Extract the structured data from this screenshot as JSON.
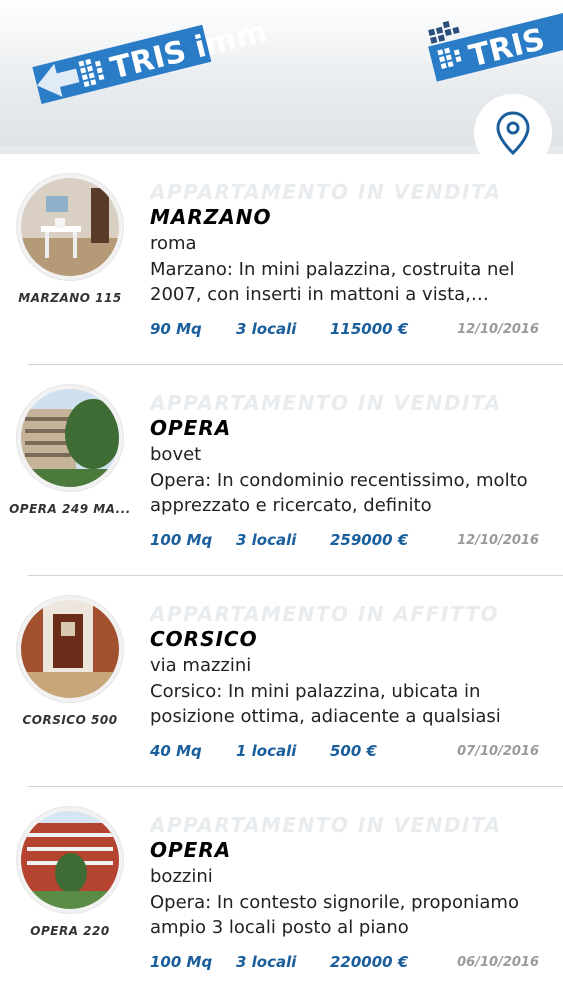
{
  "header": {
    "logo_left_text": "TRIS imm",
    "logo_right_text": "TRIS",
    "map_button_icon": "map-pin-icon"
  },
  "colors": {
    "brand_blue": "#1a5e9c",
    "logo_blue": "#2a7cc7",
    "date_gray": "#9a9a9a",
    "watermark_gray": "#e9ecef"
  },
  "listings": [
    {
      "type": "APPARTAMENTO IN VENDITA",
      "city": "MARZANO",
      "street": "roma",
      "description": "Marzano: In mini palazzina, costruita nel 2007, con inserti in mattoni a vista, proponiamo",
      "ref": "MARZANO 115",
      "mq": "90 Mq",
      "rooms": "3 locali",
      "price": "115000 €",
      "date": "12/10/2016"
    },
    {
      "type": "APPARTAMENTO IN VENDITA",
      "city": "OPERA",
      "street": "bovet",
      "description": "Opera: In condominio recentissimo, molto apprezzato e ricercato, definito",
      "ref": "OPERA 249 MA...",
      "mq": "100 Mq",
      "rooms": "3 locali",
      "price": "259000 €",
      "date": "12/10/2016"
    },
    {
      "type": "APPARTAMENTO IN AFFITTO",
      "city": "CORSICO",
      "street": "via mazzini",
      "description": "Corsico: In mini palazzina, ubicata in posizione ottima, adiacente a qualsiasi",
      "ref": "CORSICO 500",
      "mq": "40 Mq",
      "rooms": "1 locali",
      "price": "500 €",
      "date": "07/10/2016"
    },
    {
      "type": "APPARTAMENTO IN VENDITA",
      "city": "OPERA",
      "street": "bozzini",
      "description": "Opera: In contesto signorile, proponiamo ampio 3 locali posto al piano",
      "ref": "OPERA 220",
      "mq": "100 Mq",
      "rooms": "3 locali",
      "price": "220000 €",
      "date": "06/10/2016"
    }
  ]
}
